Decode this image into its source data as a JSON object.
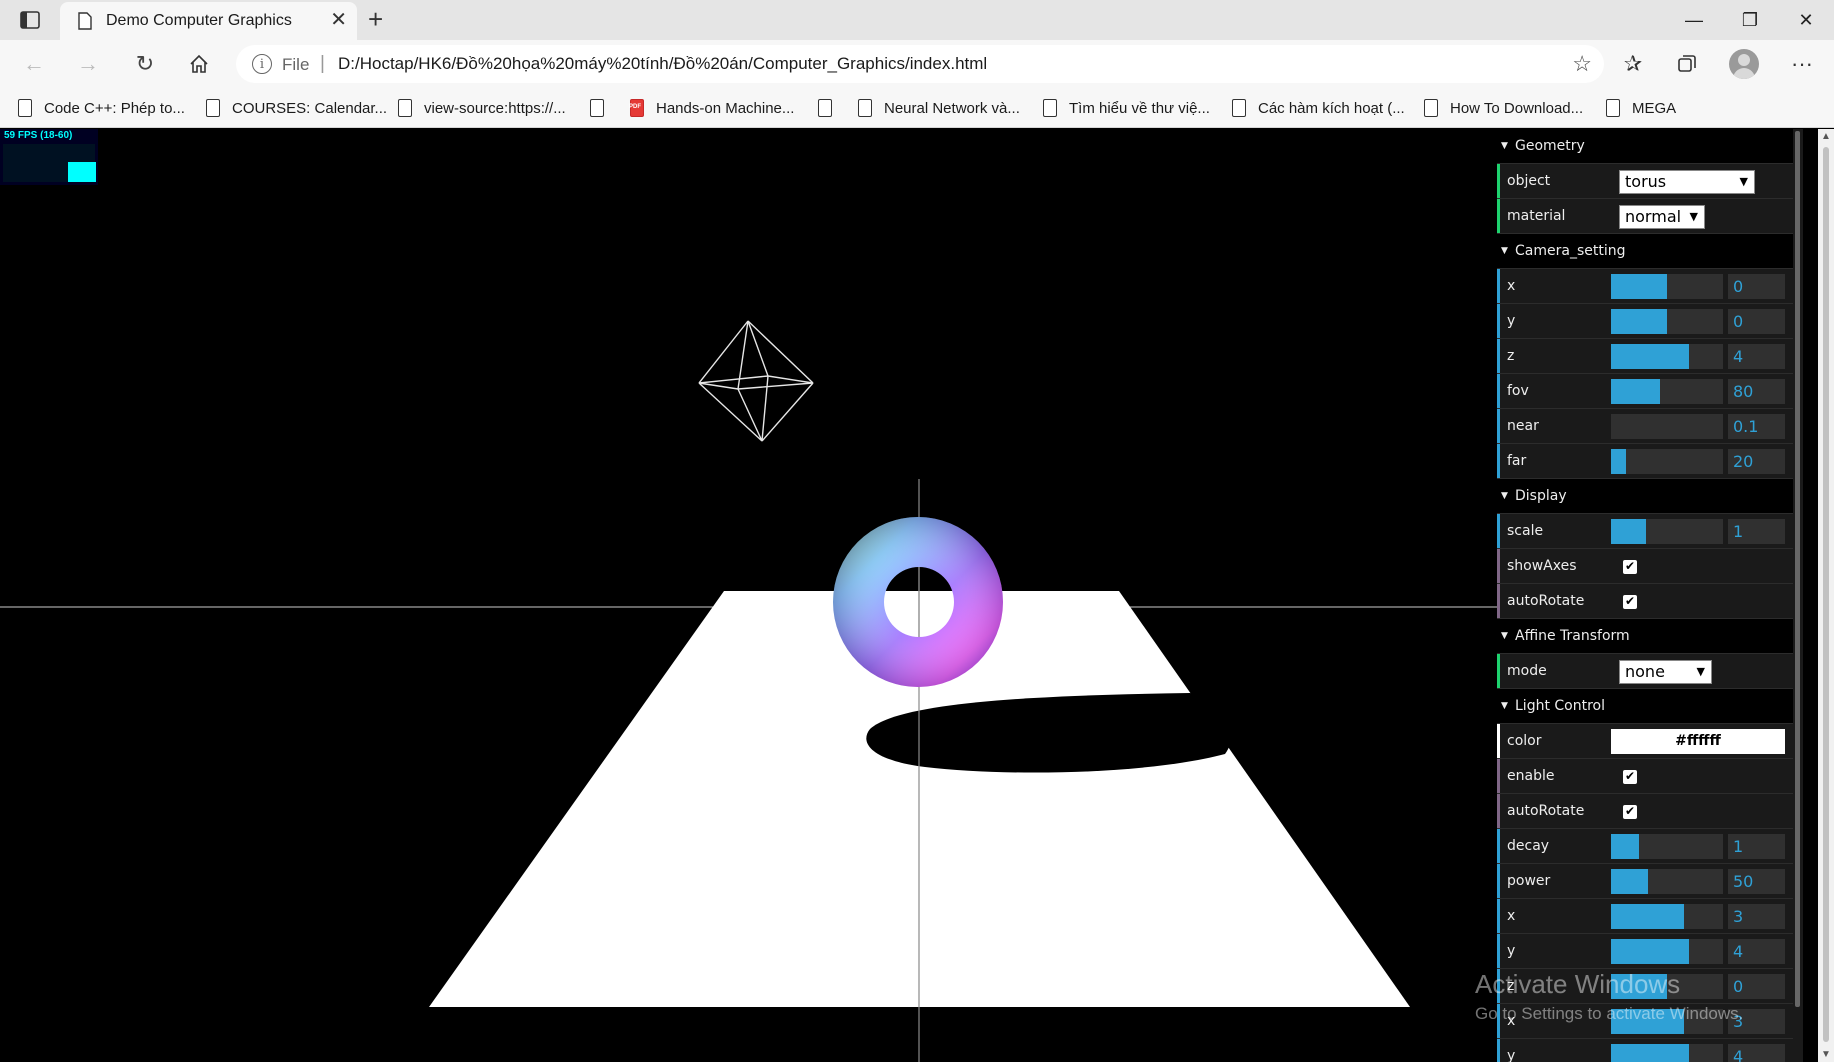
{
  "browser": {
    "tab_title": "Demo Computer Graphics",
    "tab_close": "✕",
    "new_tab": "+",
    "window_controls": {
      "minimize": "—",
      "restore": "❐",
      "close": "✕"
    },
    "url_scheme": "File",
    "url": "D:/Hoctap/HK6/Đồ%20họa%20máy%20tính/Đồ%20án/Computer_Graphics/index.html",
    "bookmarks": [
      {
        "label": "Code C++: Phép to...",
        "icon": "page-icon"
      },
      {
        "label": "COURSES: Calendar...",
        "icon": "page-icon"
      },
      {
        "label": "view-source:https://...",
        "icon": "page-icon"
      },
      {
        "label": "",
        "icon": "page-icon"
      },
      {
        "label": "Hands-on Machine...",
        "icon": "pdf-icon"
      },
      {
        "label": "",
        "icon": "page-icon"
      },
      {
        "label": "Neural Network và...",
        "icon": "page-icon"
      },
      {
        "label": "Tìm hiểu về thư việ...",
        "icon": "page-icon"
      },
      {
        "label": "Các hàm kích hoạt (...",
        "icon": "page-icon"
      },
      {
        "label": "How To Download...",
        "icon": "page-icon"
      },
      {
        "label": "MEGA",
        "icon": "page-icon"
      }
    ]
  },
  "stats": {
    "fps_label": "59 FPS (18-60)"
  },
  "gui": {
    "geometry": {
      "title": "Geometry",
      "object": {
        "label": "object",
        "value": "torus"
      },
      "material": {
        "label": "material",
        "value": "normal"
      }
    },
    "camera": {
      "title": "Camera_setting",
      "x": {
        "label": "x",
        "value": "0",
        "fraction": 0.5
      },
      "y": {
        "label": "y",
        "value": "0",
        "fraction": 0.5
      },
      "z": {
        "label": "z",
        "value": "4",
        "fraction": 0.7
      },
      "fov": {
        "label": "fov",
        "value": "80",
        "fraction": 0.44
      },
      "near": {
        "label": "near",
        "value": "0.1",
        "fraction": 0.0
      },
      "far": {
        "label": "far",
        "value": "20",
        "fraction": 0.13
      }
    },
    "display": {
      "title": "Display",
      "scale": {
        "label": "scale",
        "value": "1",
        "fraction": 0.31
      },
      "showAxes": {
        "label": "showAxes",
        "checked": true
      },
      "autoRotate": {
        "label": "autoRotate",
        "checked": true
      }
    },
    "affine": {
      "title": "Affine Transform",
      "mode": {
        "label": "mode",
        "value": "none"
      }
    },
    "light": {
      "title": "Light Control",
      "color": {
        "label": "color",
        "value": "#ffffff"
      },
      "enable": {
        "label": "enable",
        "checked": true
      },
      "autoRotate": {
        "label": "autoRotate",
        "checked": true
      },
      "decay": {
        "label": "decay",
        "value": "1",
        "fraction": 0.25
      },
      "power": {
        "label": "power",
        "value": "50",
        "fraction": 0.33
      },
      "x": {
        "label": "x",
        "value": "3",
        "fraction": 0.65
      },
      "y": {
        "label": "y",
        "value": "4",
        "fraction": 0.7
      },
      "z": {
        "label": "z",
        "value": "0",
        "fraction": 0.5
      },
      "rx": {
        "label": "x",
        "value": "3",
        "fraction": 0.65
      },
      "ry": {
        "label": "y",
        "value": "4",
        "fraction": 0.7
      }
    }
  },
  "watermark": {
    "title": "Activate Windows",
    "subtitle": "Go to Settings to activate Windows."
  },
  "colors": {
    "gui_number": "#2fa1d6",
    "gui_select": "#1ed36f",
    "gui_bool": "#806787",
    "stats_fg": "#00ffff"
  }
}
